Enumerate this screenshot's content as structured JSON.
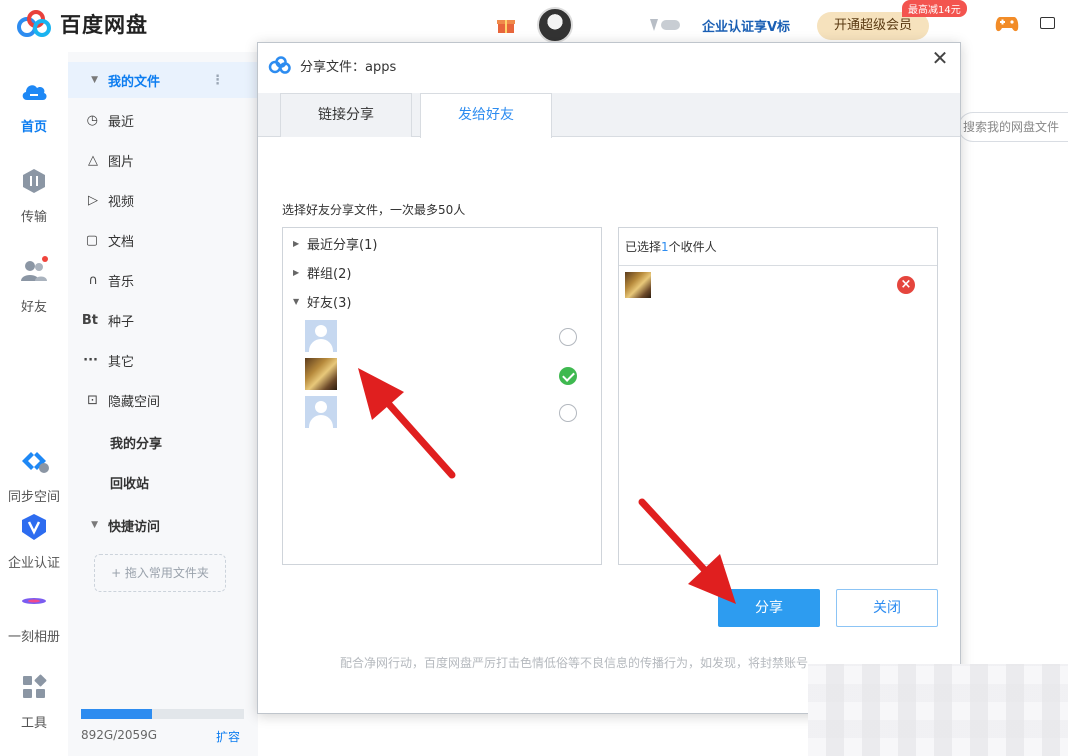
{
  "header": {
    "app_title": "百度网盘",
    "enterprise_label": "企业认证享V标",
    "vip_button": "开通超级会员",
    "promo_badge": "最高减14元"
  },
  "rail": [
    {
      "label": "首页",
      "icon": "home-cloud-icon",
      "active": true
    },
    {
      "label": "传输",
      "icon": "transfer-icon"
    },
    {
      "label": "好友",
      "icon": "friends-icon"
    },
    {
      "label": "同步空间",
      "icon": "sync-space-icon"
    },
    {
      "label": "企业认证",
      "icon": "enterprise-verify-icon"
    },
    {
      "label": "一刻相册",
      "icon": "album-icon"
    },
    {
      "label": "工具",
      "icon": "tools-icon"
    }
  ],
  "sidebar": {
    "my_files": "我的文件",
    "items": [
      {
        "label": "最近",
        "icon": "clock-icon"
      },
      {
        "label": "图片",
        "icon": "image-icon"
      },
      {
        "label": "视频",
        "icon": "play-icon"
      },
      {
        "label": "文档",
        "icon": "document-icon"
      },
      {
        "label": "音乐",
        "icon": "headphones-icon"
      },
      {
        "label": "种子",
        "icon": "bt-icon",
        "glyph": "Bt"
      },
      {
        "label": "其它",
        "icon": "more-icon",
        "glyph": "···"
      },
      {
        "label": "隐藏空间",
        "icon": "lock-icon"
      }
    ],
    "my_share": "我的分享",
    "recycle_bin": "回收站",
    "quick_access": "快捷访问",
    "drag_hint": "+ 拖入常用文件夹",
    "storage_text": "892G/2059G",
    "storage_fraction": 0.433,
    "expand": "扩容"
  },
  "background": {
    "search_placeholder": "搜索我的网盘文件"
  },
  "dialog": {
    "title": "分享文件：apps",
    "tabs": [
      {
        "label": "链接分享",
        "active": false
      },
      {
        "label": "发给好友",
        "active": true
      }
    ],
    "hint": "选择好友分享文件，一次最多50人",
    "tree": {
      "recent": "最近分享(1)",
      "groups": "群组(2)",
      "friends": "好友(3)"
    },
    "friends": [
      {
        "avatar": "default",
        "checked": false
      },
      {
        "avatar": "photo",
        "checked": true
      },
      {
        "avatar": "default",
        "checked": false
      }
    ],
    "selected_prefix": "已选择",
    "selected_count": "1",
    "selected_suffix": "个收件人",
    "share_button": "分享",
    "close_button": "关闭",
    "notice": "配合净网行动，百度网盘严厉打击色情低俗等不良信息的传播行为，如发现，将封禁账号。"
  },
  "colors": {
    "accent": "#2d8cf0",
    "annotation_arrow": "#e01f1f",
    "checked": "#3fb950",
    "remove": "#e5453d"
  }
}
